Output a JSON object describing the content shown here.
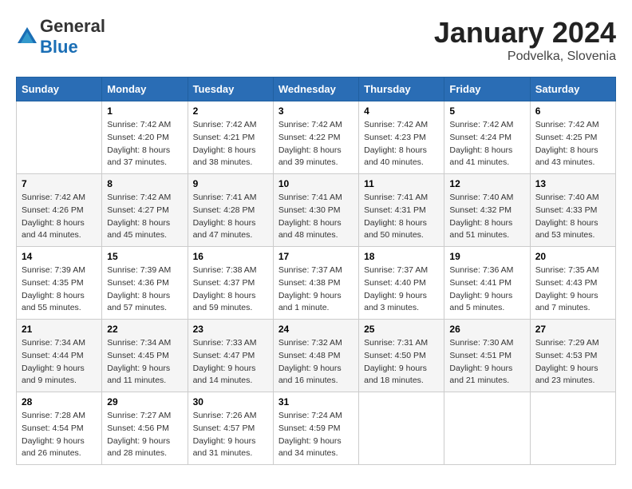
{
  "header": {
    "logo_general": "General",
    "logo_blue": "Blue",
    "month_year": "January 2024",
    "location": "Podvelka, Slovenia"
  },
  "calendar": {
    "days_of_week": [
      "Sunday",
      "Monday",
      "Tuesday",
      "Wednesday",
      "Thursday",
      "Friday",
      "Saturday"
    ],
    "weeks": [
      [
        {
          "day": "",
          "sunrise": "",
          "sunset": "",
          "daylight": ""
        },
        {
          "day": "1",
          "sunrise": "Sunrise: 7:42 AM",
          "sunset": "Sunset: 4:20 PM",
          "daylight": "Daylight: 8 hours and 37 minutes."
        },
        {
          "day": "2",
          "sunrise": "Sunrise: 7:42 AM",
          "sunset": "Sunset: 4:21 PM",
          "daylight": "Daylight: 8 hours and 38 minutes."
        },
        {
          "day": "3",
          "sunrise": "Sunrise: 7:42 AM",
          "sunset": "Sunset: 4:22 PM",
          "daylight": "Daylight: 8 hours and 39 minutes."
        },
        {
          "day": "4",
          "sunrise": "Sunrise: 7:42 AM",
          "sunset": "Sunset: 4:23 PM",
          "daylight": "Daylight: 8 hours and 40 minutes."
        },
        {
          "day": "5",
          "sunrise": "Sunrise: 7:42 AM",
          "sunset": "Sunset: 4:24 PM",
          "daylight": "Daylight: 8 hours and 41 minutes."
        },
        {
          "day": "6",
          "sunrise": "Sunrise: 7:42 AM",
          "sunset": "Sunset: 4:25 PM",
          "daylight": "Daylight: 8 hours and 43 minutes."
        }
      ],
      [
        {
          "day": "7",
          "sunrise": "Sunrise: 7:42 AM",
          "sunset": "Sunset: 4:26 PM",
          "daylight": "Daylight: 8 hours and 44 minutes."
        },
        {
          "day": "8",
          "sunrise": "Sunrise: 7:42 AM",
          "sunset": "Sunset: 4:27 PM",
          "daylight": "Daylight: 8 hours and 45 minutes."
        },
        {
          "day": "9",
          "sunrise": "Sunrise: 7:41 AM",
          "sunset": "Sunset: 4:28 PM",
          "daylight": "Daylight: 8 hours and 47 minutes."
        },
        {
          "day": "10",
          "sunrise": "Sunrise: 7:41 AM",
          "sunset": "Sunset: 4:30 PM",
          "daylight": "Daylight: 8 hours and 48 minutes."
        },
        {
          "day": "11",
          "sunrise": "Sunrise: 7:41 AM",
          "sunset": "Sunset: 4:31 PM",
          "daylight": "Daylight: 8 hours and 50 minutes."
        },
        {
          "day": "12",
          "sunrise": "Sunrise: 7:40 AM",
          "sunset": "Sunset: 4:32 PM",
          "daylight": "Daylight: 8 hours and 51 minutes."
        },
        {
          "day": "13",
          "sunrise": "Sunrise: 7:40 AM",
          "sunset": "Sunset: 4:33 PM",
          "daylight": "Daylight: 8 hours and 53 minutes."
        }
      ],
      [
        {
          "day": "14",
          "sunrise": "Sunrise: 7:39 AM",
          "sunset": "Sunset: 4:35 PM",
          "daylight": "Daylight: 8 hours and 55 minutes."
        },
        {
          "day": "15",
          "sunrise": "Sunrise: 7:39 AM",
          "sunset": "Sunset: 4:36 PM",
          "daylight": "Daylight: 8 hours and 57 minutes."
        },
        {
          "day": "16",
          "sunrise": "Sunrise: 7:38 AM",
          "sunset": "Sunset: 4:37 PM",
          "daylight": "Daylight: 8 hours and 59 minutes."
        },
        {
          "day": "17",
          "sunrise": "Sunrise: 7:37 AM",
          "sunset": "Sunset: 4:38 PM",
          "daylight": "Daylight: 9 hours and 1 minute."
        },
        {
          "day": "18",
          "sunrise": "Sunrise: 7:37 AM",
          "sunset": "Sunset: 4:40 PM",
          "daylight": "Daylight: 9 hours and 3 minutes."
        },
        {
          "day": "19",
          "sunrise": "Sunrise: 7:36 AM",
          "sunset": "Sunset: 4:41 PM",
          "daylight": "Daylight: 9 hours and 5 minutes."
        },
        {
          "day": "20",
          "sunrise": "Sunrise: 7:35 AM",
          "sunset": "Sunset: 4:43 PM",
          "daylight": "Daylight: 9 hours and 7 minutes."
        }
      ],
      [
        {
          "day": "21",
          "sunrise": "Sunrise: 7:34 AM",
          "sunset": "Sunset: 4:44 PM",
          "daylight": "Daylight: 9 hours and 9 minutes."
        },
        {
          "day": "22",
          "sunrise": "Sunrise: 7:34 AM",
          "sunset": "Sunset: 4:45 PM",
          "daylight": "Daylight: 9 hours and 11 minutes."
        },
        {
          "day": "23",
          "sunrise": "Sunrise: 7:33 AM",
          "sunset": "Sunset: 4:47 PM",
          "daylight": "Daylight: 9 hours and 14 minutes."
        },
        {
          "day": "24",
          "sunrise": "Sunrise: 7:32 AM",
          "sunset": "Sunset: 4:48 PM",
          "daylight": "Daylight: 9 hours and 16 minutes."
        },
        {
          "day": "25",
          "sunrise": "Sunrise: 7:31 AM",
          "sunset": "Sunset: 4:50 PM",
          "daylight": "Daylight: 9 hours and 18 minutes."
        },
        {
          "day": "26",
          "sunrise": "Sunrise: 7:30 AM",
          "sunset": "Sunset: 4:51 PM",
          "daylight": "Daylight: 9 hours and 21 minutes."
        },
        {
          "day": "27",
          "sunrise": "Sunrise: 7:29 AM",
          "sunset": "Sunset: 4:53 PM",
          "daylight": "Daylight: 9 hours and 23 minutes."
        }
      ],
      [
        {
          "day": "28",
          "sunrise": "Sunrise: 7:28 AM",
          "sunset": "Sunset: 4:54 PM",
          "daylight": "Daylight: 9 hours and 26 minutes."
        },
        {
          "day": "29",
          "sunrise": "Sunrise: 7:27 AM",
          "sunset": "Sunset: 4:56 PM",
          "daylight": "Daylight: 9 hours and 28 minutes."
        },
        {
          "day": "30",
          "sunrise": "Sunrise: 7:26 AM",
          "sunset": "Sunset: 4:57 PM",
          "daylight": "Daylight: 9 hours and 31 minutes."
        },
        {
          "day": "31",
          "sunrise": "Sunrise: 7:24 AM",
          "sunset": "Sunset: 4:59 PM",
          "daylight": "Daylight: 9 hours and 34 minutes."
        },
        {
          "day": "",
          "sunrise": "",
          "sunset": "",
          "daylight": ""
        },
        {
          "day": "",
          "sunrise": "",
          "sunset": "",
          "daylight": ""
        },
        {
          "day": "",
          "sunrise": "",
          "sunset": "",
          "daylight": ""
        }
      ]
    ]
  }
}
